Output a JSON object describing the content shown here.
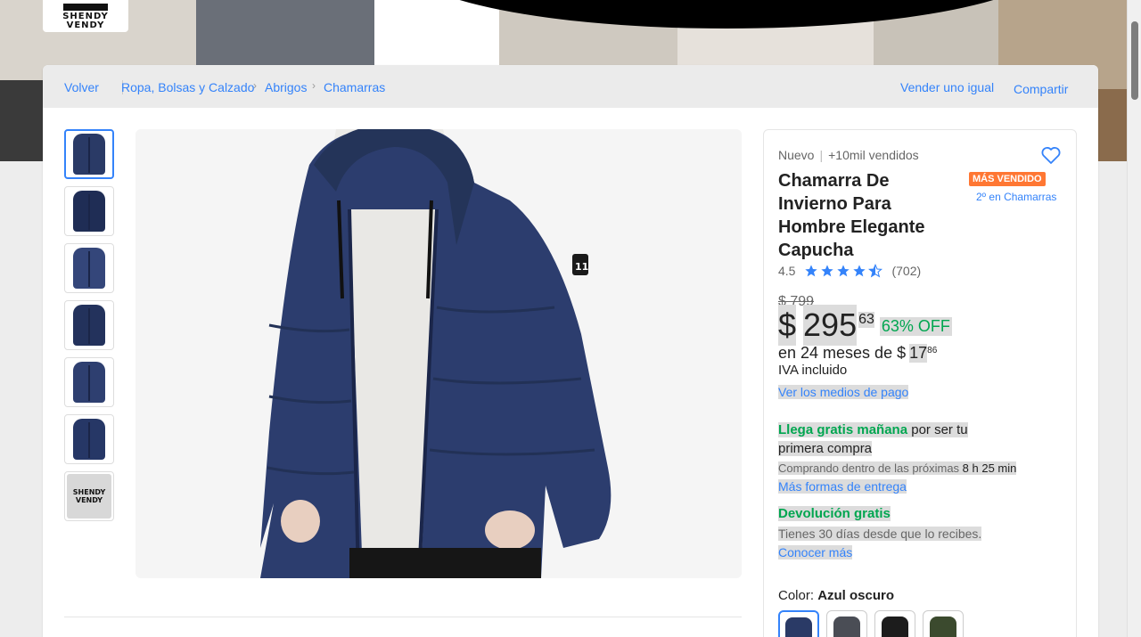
{
  "store": {
    "logo_text_line1": "SHENDY",
    "logo_text_line2": "VENDY"
  },
  "breadcrumb": {
    "back": "Volver",
    "items": [
      "Ropa, Bolsas y Calzado",
      "Abrigos",
      "Chamarras"
    ],
    "sell_similar": "Vender uno igual",
    "share": "Compartir"
  },
  "gallery": {
    "thumbnails": [
      "jacket-front",
      "jacket-hood",
      "jacket-model",
      "jacket-side",
      "jacket-detail",
      "jacket-back",
      "store-logo"
    ],
    "selected_index": 0,
    "thumb_logo_text": "SHENDY VENDY"
  },
  "product": {
    "condition": "Nuevo",
    "sold": "+10mil vendidos",
    "title": "Chamarra De Invierno Para Hombre Elegante Capucha",
    "badge": "MÁS VENDIDO",
    "rank": "2º en Chamarras",
    "rating": "4.5",
    "stars": 4.5,
    "reviews": "(702)",
    "old_price": "$ 799",
    "currency": "$",
    "price": "295",
    "cents": "63",
    "discount": "63% OFF",
    "installments_text": "en 24 meses de $",
    "installment_amount": "17",
    "installment_cents": "86",
    "tax": "IVA incluido",
    "payment_link": "Ver los medios de pago"
  },
  "shipping": {
    "highlight": "Llega gratis mañana",
    "rest": " por ser tu primera compra",
    "time_prefix": "Comprando dentro de las próximas ",
    "time_value": "8 h 25 min",
    "more_link": "Más formas de entrega"
  },
  "returns": {
    "title": "Devolución gratis",
    "text": "Tienes 30 días desde que lo recibes.",
    "link": "Conocer más"
  },
  "color": {
    "label": "Color: ",
    "selected": "Azul oscuro",
    "options": [
      "#2a3a66",
      "#4a4d55",
      "#1c1c1c",
      "#3b4a2e"
    ]
  },
  "colors": {
    "accent": "#3483fa",
    "green": "#00a650",
    "badge": "#ff7733",
    "jacket": "#2c3d6e"
  }
}
